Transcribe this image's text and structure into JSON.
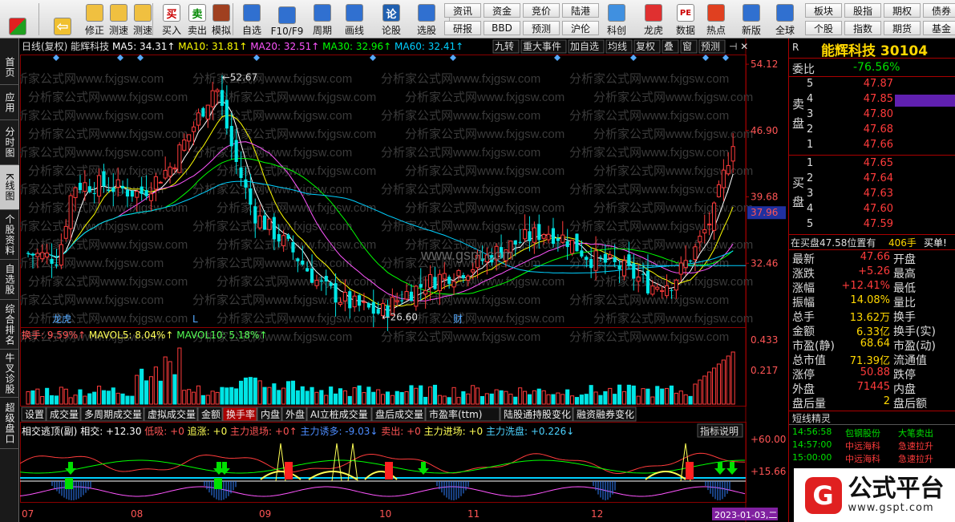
{
  "toolbar": {
    "buttons": [
      {
        "label": "",
        "icon": "windows-icon"
      },
      {
        "label": "",
        "icon": "back-arrow-icon"
      },
      {
        "label": "修正",
        "icon": "up-down-arrow-icon"
      },
      {
        "label": "测速",
        "icon": "speed-icon"
      },
      {
        "label": "测速",
        "icon": "clock-icon"
      },
      {
        "label": "买入",
        "icon": "buy-icon",
        "glyph": "买"
      },
      {
        "label": "卖出",
        "icon": "sell-icon",
        "glyph": "卖"
      },
      {
        "label": "模拟",
        "icon": "hammer-icon"
      },
      {
        "label": "自选",
        "icon": "star-icon"
      },
      {
        "label": "F10/F9",
        "icon": "f10-icon"
      },
      {
        "label": "周期",
        "icon": "period-icon"
      },
      {
        "label": "画线",
        "icon": "pencil-icon"
      },
      {
        "label": "论股",
        "icon": "forum-icon",
        "glyph": "论"
      },
      {
        "label": "选股",
        "icon": "select-stock-icon"
      }
    ],
    "grid1": [
      "资讯",
      "资金",
      "竞价",
      "陆港"
    ],
    "grid2": [
      "研报",
      "BBD",
      "预测",
      "沪伦"
    ],
    "buttons2": [
      {
        "label": "科创",
        "icon": "kechuang-icon"
      },
      {
        "label": "龙虎",
        "icon": "dragon-tiger-icon"
      },
      {
        "label": "数据",
        "icon": "pe-data-icon",
        "glyph": "PE"
      },
      {
        "label": "热点",
        "icon": "hot-icon"
      },
      {
        "label": "新版",
        "icon": "new-version-icon"
      },
      {
        "label": "全球",
        "icon": "globe-icon"
      }
    ],
    "grid3": [
      "板块",
      "股指",
      "期权",
      "债券"
    ],
    "grid4": [
      "个股",
      "指数",
      "期货",
      "基金"
    ]
  },
  "lefttabs": [
    "首页",
    "应用",
    "分时图",
    "K线图",
    "个股资料",
    "自选股",
    "综合排名",
    "牛叉诊股",
    "超级盘口"
  ],
  "kline": {
    "header_prefix": "日线(复权)  能辉科技",
    "ma": [
      {
        "label": "MA5: 34.31↑",
        "color": "#ffffff"
      },
      {
        "label": "MA10: 31.81↑",
        "color": "#ffff00"
      },
      {
        "label": "MA20: 32.51↑",
        "color": "#ff55ff"
      },
      {
        "label": "MA30: 32.96↑",
        "color": "#00ff00"
      },
      {
        "label": "MA60: 32.41↑",
        "color": "#00d0ff"
      }
    ],
    "tool_buttons": [
      "九转",
      "重大事件",
      "加自选",
      "均线",
      "复权",
      "叠",
      "窗",
      "预测"
    ],
    "price_axis": [
      "54.12",
      "46.90",
      "39.68",
      "37.96",
      "32.46"
    ],
    "high_label": "52.67",
    "low_label": "26.60",
    "events": [
      "龙虎",
      "L",
      "财"
    ],
    "watermark": "分析家公式网www.fxjgsw.com",
    "center_watermark": "www.gspt.com"
  },
  "chart_data": {
    "type": "candlestick",
    "period": "daily",
    "months": [
      "07",
      "08",
      "09",
      "10",
      "11",
      "12"
    ],
    "price_axis_ticks": [
      54.12,
      46.9,
      39.68,
      32.46
    ],
    "last_price_marker": 37.96,
    "high": 52.67,
    "low": 26.6,
    "moving_averages": {
      "MA5": 34.31,
      "MA10": 31.81,
      "MA20": 32.51,
      "MA30": 32.96,
      "MA60": 32.41
    },
    "turnover_axis": [
      0.433,
      0.217
    ],
    "turnover": {
      "换手": "9.59%",
      "MAVOL5": "8.04%",
      "MAVOL10": "5.18%"
    },
    "indicator_axis": [
      60.0,
      15.66
    ],
    "indicator": {
      "name": "相交逃顶(副)",
      "相交": 12.3,
      "低吸": 0,
      "追涨": 0,
      "主力退场": 0,
      "主力诱多": -9.03,
      "卖出": 0,
      "主力进场": 0,
      "主力洗盘": 0.226
    }
  },
  "volume": {
    "legend": [
      {
        "label": "换手: 9.59%↑",
        "color": "#ff5555"
      },
      {
        "label": "MAVOL5: 8.04%↑",
        "color": "#ffff55"
      },
      {
        "label": "MAVOL10: 5.18%↑",
        "color": "#55ff55"
      }
    ],
    "axis": [
      "0.433",
      "0.217"
    ]
  },
  "tabs": [
    "设置",
    "成交量",
    "多周期成交量",
    "虚拟成交量",
    "金额",
    "换手率",
    "内盘",
    "外盘",
    "AI立桩成交量",
    "盘后成交量",
    "市盈率(ttm)",
    "陆股通持股变化",
    "融资融券变化"
  ],
  "active_tab": "换手率",
  "indicator": {
    "legend": [
      {
        "label": "相交逃顶(副)",
        "color": "#ffffff"
      },
      {
        "label": "相交: +12.30",
        "color": "#ffffff"
      },
      {
        "label": "低吸: +0",
        "color": "#ff5555"
      },
      {
        "label": "追涨: +0",
        "color": "#ffff55"
      },
      {
        "label": "主力退场: +0↑",
        "color": "#ff5555"
      },
      {
        "label": "主力诱多: -9.03↓",
        "color": "#4c8cff"
      },
      {
        "label": "卖出: +0",
        "color": "#ff5555"
      },
      {
        "label": "主力进场: +0",
        "color": "#ffff55"
      },
      {
        "label": "主力洗盘: +0.226↓",
        "color": "#4cd2ff"
      }
    ],
    "explain": "指标说明",
    "axis": [
      "+60.00",
      "+15.66"
    ],
    "date_label": "2023-01-03,二"
  },
  "quote": {
    "name": "能辉科技",
    "code": "30104",
    "r": "R",
    "weibi_label": "委比",
    "weibi": "-76.56%",
    "sell_label": "卖盘",
    "buy_label": "买盘",
    "asks": [
      {
        "lvl": "5",
        "price": "47.87"
      },
      {
        "lvl": "4",
        "price": "47.85"
      },
      {
        "lvl": "3",
        "price": "47.80"
      },
      {
        "lvl": "2",
        "price": "47.68"
      },
      {
        "lvl": "1",
        "price": "47.66"
      }
    ],
    "bids": [
      {
        "lvl": "1",
        "price": "47.65"
      },
      {
        "lvl": "2",
        "price": "47.64"
      },
      {
        "lvl": "3",
        "price": "47.63"
      },
      {
        "lvl": "4",
        "price": "47.60"
      },
      {
        "lvl": "5",
        "price": "47.59"
      }
    ],
    "position_text": "在买盘47.58位置有",
    "position_qty": "406手",
    "position_tag": "买单!",
    "stats": [
      {
        "l": "最新",
        "v": "47.66",
        "vc": "red",
        "r": "开盘"
      },
      {
        "l": "涨跌",
        "v": "+5.26",
        "vc": "red",
        "r": "最高"
      },
      {
        "l": "涨幅",
        "v": "+12.41%",
        "vc": "red",
        "r": "最低"
      },
      {
        "l": "振幅",
        "v": "14.08%",
        "vc": "gold",
        "r": "量比"
      },
      {
        "l": "总手",
        "v": "13.62万",
        "vc": "gold",
        "r": "换手"
      },
      {
        "l": "金额",
        "v": "6.33亿",
        "vc": "gold",
        "r": "换手(实)"
      },
      {
        "l": "市盈(静)",
        "v": "68.64",
        "vc": "gold",
        "r": "市盈(动)"
      },
      {
        "l": "总市值",
        "v": "71.39亿",
        "vc": "gold",
        "r": "流通值"
      },
      {
        "l": "涨停",
        "v": "50.88",
        "vc": "red",
        "r": "跌停"
      },
      {
        "l": "外盘",
        "v": "71445",
        "vc": "red",
        "r": "内盘"
      },
      {
        "l": "盘后量",
        "v": "2",
        "vc": "gold",
        "r": "盘后额"
      }
    ],
    "sprite_title": "短线精灵",
    "sprites": [
      {
        "t": "14:56:58",
        "n": "包钢股份",
        "e": "大笔卖出",
        "nc": "green",
        "ec": "green"
      },
      {
        "t": "14:57:00",
        "n": "中远海科",
        "e": "急速拉升",
        "nc": "red",
        "ec": "red"
      },
      {
        "t": "15:00:00",
        "n": "中远海科",
        "e": "急速拉升",
        "nc": "red",
        "ec": "red"
      }
    ]
  },
  "badge": {
    "title": "公式平台",
    "url": "www.gspt.com",
    "logo_glyph": "G"
  }
}
